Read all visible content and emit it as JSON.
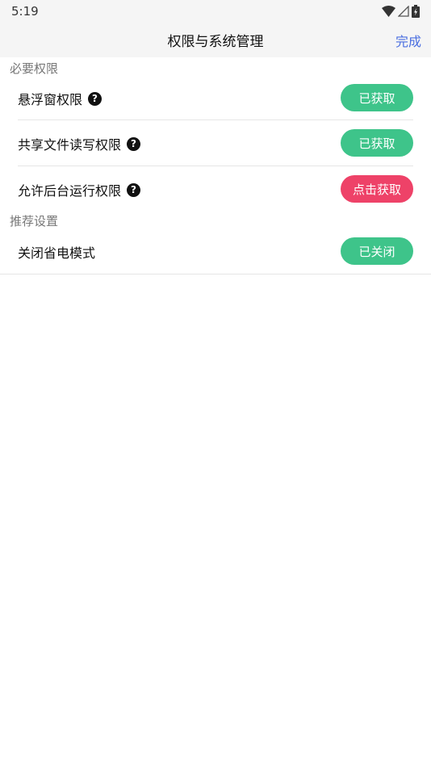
{
  "status_bar": {
    "time": "5:19",
    "icons": [
      "wifi-icon",
      "signal-icon",
      "battery-icon"
    ]
  },
  "header": {
    "title": "权限与系统管理",
    "done_label": "完成",
    "done_color": "#4a6ee0"
  },
  "sections": {
    "required": {
      "label": "必要权限",
      "items": [
        {
          "label": "悬浮窗权限",
          "icon": "help-icon",
          "status": "已获取",
          "status_color": "#3ec48a"
        },
        {
          "label": "共享文件读写权限",
          "icon": "help-icon",
          "status": "已获取",
          "status_color": "#3ec48a"
        },
        {
          "label": "允许后台运行权限",
          "icon": "help-icon",
          "status": "点击获取",
          "status_color": "#ee4268"
        }
      ]
    },
    "recommended": {
      "label": "推荐设置",
      "items": [
        {
          "label": "关闭省电模式",
          "status": "已关闭",
          "status_color": "#3ec48a"
        }
      ]
    }
  }
}
